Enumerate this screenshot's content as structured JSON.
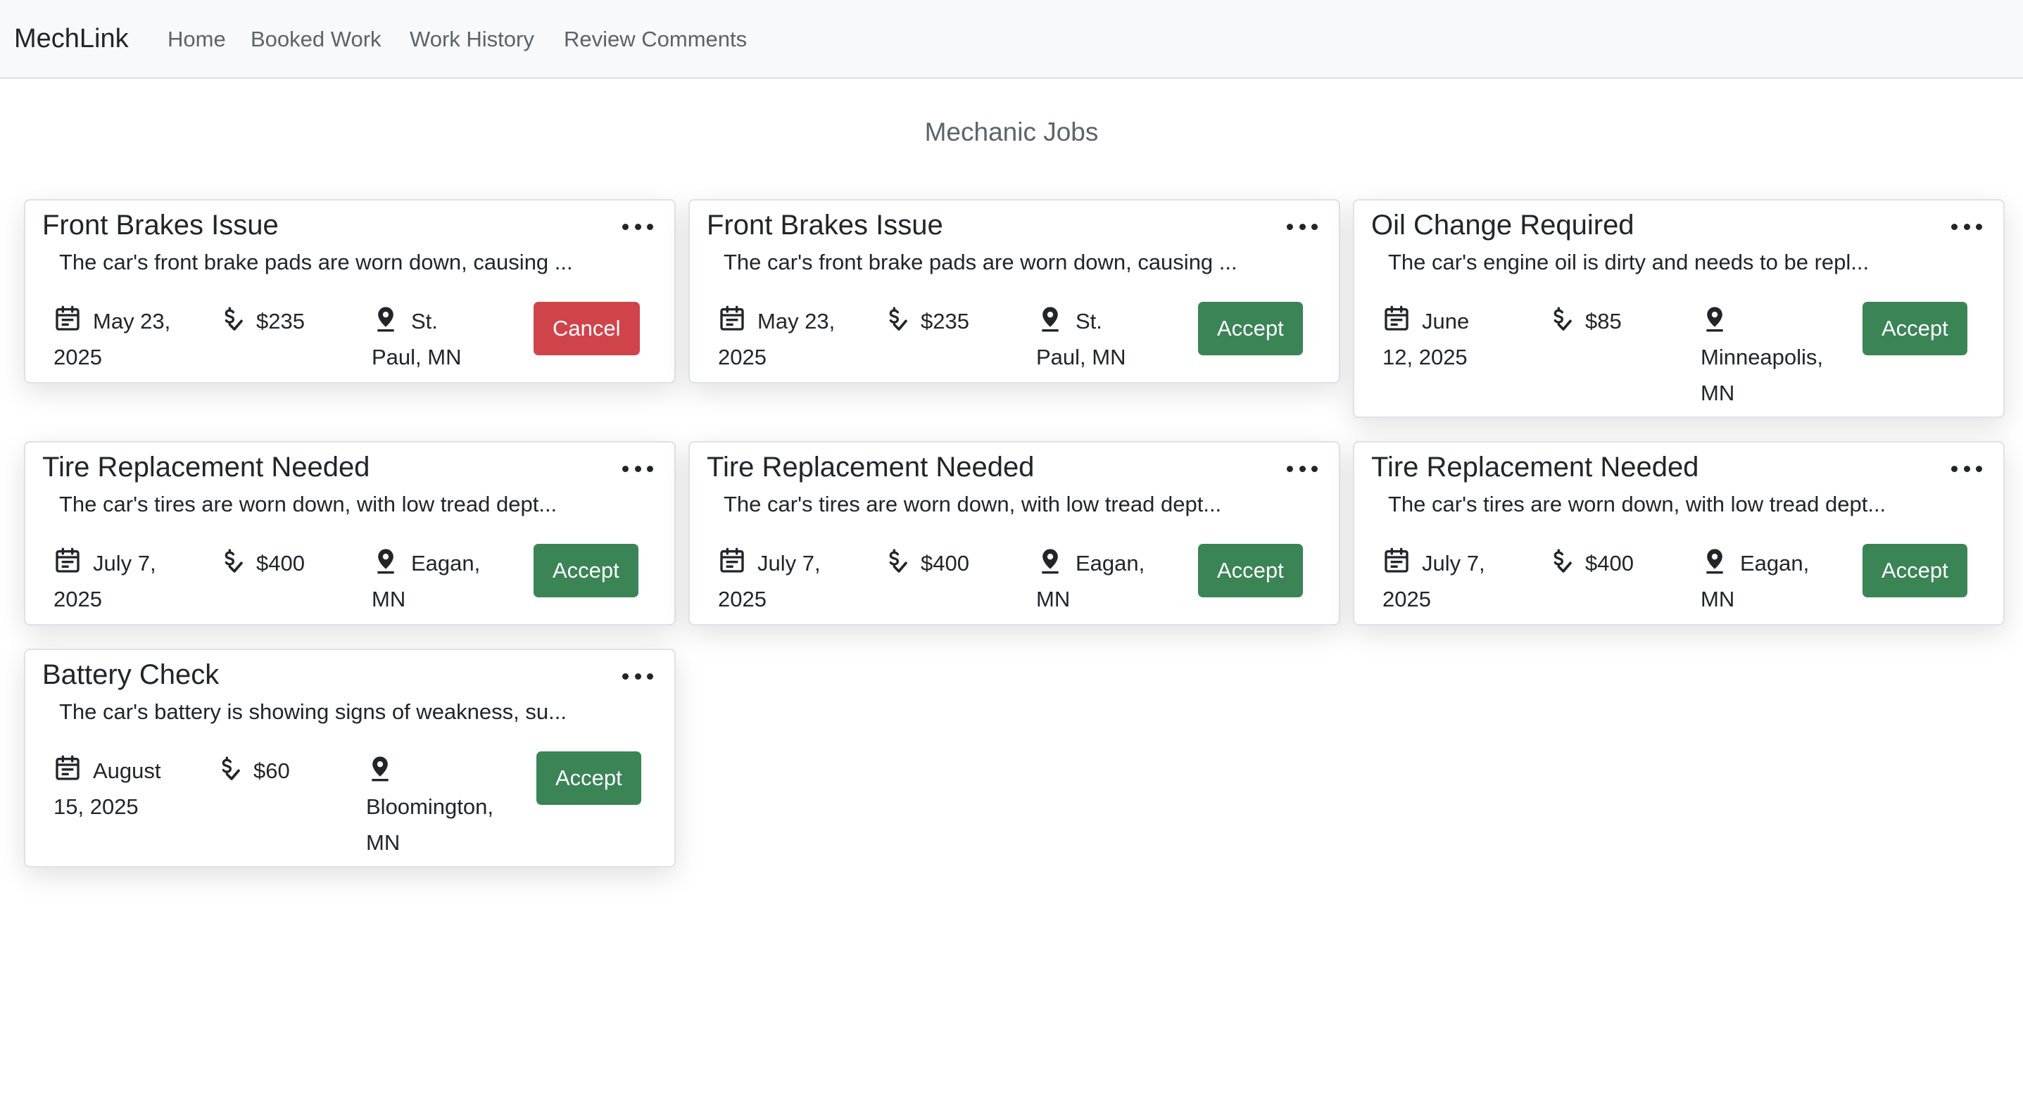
{
  "nav": {
    "brand": "MechLink",
    "links": [
      "Home",
      "Booked Work",
      "Work History",
      "Review Comments"
    ]
  },
  "page": {
    "title": "Mechanic Jobs"
  },
  "colors": {
    "accept": "#3a8456",
    "cancel": "#d1434b",
    "navbar_bg": "#f8f9fa"
  },
  "icons": {
    "date": "calendar-icon",
    "price": "dollar-check-icon",
    "location": "map-pin-icon",
    "menu": "more-horizontal-icon"
  },
  "jobs": [
    {
      "title": "Front Brakes Issue",
      "desc": "The car's front brake pads are worn down, causing ...",
      "date_l1": "May 23,",
      "date_l2": "2025",
      "price": "$235",
      "loc_l1": "St.",
      "loc_l2": "Paul, MN",
      "loc_l3": "",
      "action": "Cancel"
    },
    {
      "title": "Front Brakes Issue",
      "desc": "The car's front brake pads are worn down, causing ...",
      "date_l1": "May 23,",
      "date_l2": "2025",
      "price": "$235",
      "loc_l1": "St.",
      "loc_l2": "Paul, MN",
      "loc_l3": "",
      "action": "Accept"
    },
    {
      "title": "Oil Change Required",
      "desc": "The car's engine oil is dirty and needs to be repl...",
      "date_l1": "June",
      "date_l2": "12, 2025",
      "price": "$85",
      "loc_l1": "",
      "loc_l2": "Minneapolis,",
      "loc_l3": "MN",
      "action": "Accept"
    },
    {
      "title": "Tire Replacement Needed",
      "desc": "The car's tires are worn down, with low tread dept...",
      "date_l1": "July 7,",
      "date_l2": "2025",
      "price": "$400",
      "loc_l1": "Eagan,",
      "loc_l2": "MN",
      "loc_l3": "",
      "action": "Accept"
    },
    {
      "title": "Tire Replacement Needed",
      "desc": "The car's tires are worn down, with low tread dept...",
      "date_l1": "July 7,",
      "date_l2": "2025",
      "price": "$400",
      "loc_l1": "Eagan,",
      "loc_l2": "MN",
      "loc_l3": "",
      "action": "Accept"
    },
    {
      "title": "Tire Replacement Needed",
      "desc": "The car's tires are worn down, with low tread dept...",
      "date_l1": "July 7,",
      "date_l2": "2025",
      "price": "$400",
      "loc_l1": "Eagan,",
      "loc_l2": "MN",
      "loc_l3": "",
      "action": "Accept"
    },
    {
      "title": "Battery Check",
      "desc": "The car's battery is showing signs of weakness, su...",
      "date_l1": "August",
      "date_l2": "15, 2025",
      "price": "$60",
      "loc_l1": "",
      "loc_l2": "Bloomington,",
      "loc_l3": "MN",
      "action": "Accept"
    }
  ]
}
